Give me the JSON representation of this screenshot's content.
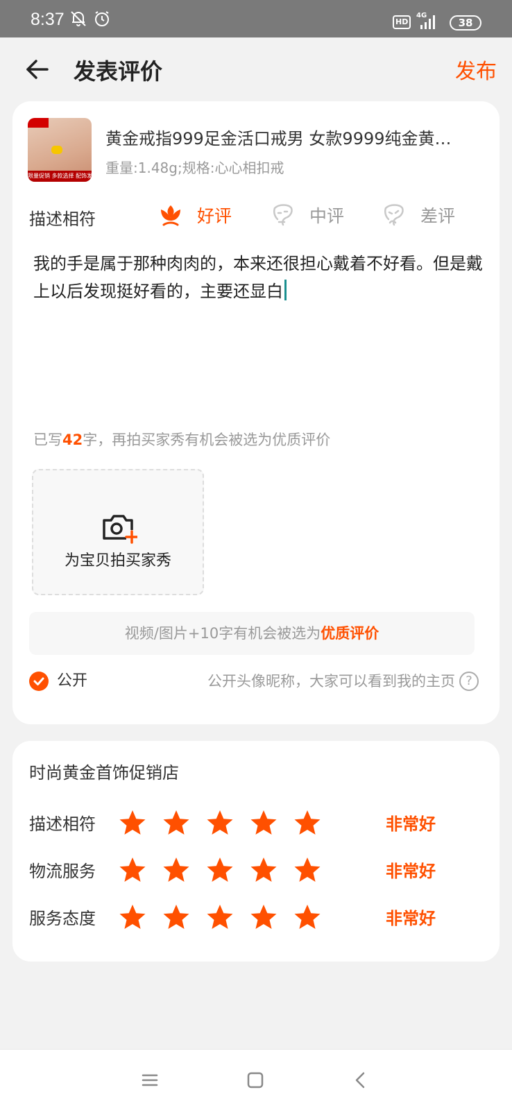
{
  "status_bar": {
    "time": "8:37",
    "hd": "HD",
    "network": "4G",
    "battery": "38"
  },
  "header": {
    "title": "发表评价",
    "publish_label": "发布"
  },
  "product": {
    "title": "黄金戒指999足金活口戒男 女款9999纯金黄…",
    "spec": "重量:1.48g;规格:心心相扣戒",
    "image_tag": "限量促销 多款选择 配饰发票"
  },
  "rating": {
    "label": "描述相符",
    "options": [
      {
        "label": "好评",
        "icon": "flower-icon",
        "selected": true
      },
      {
        "label": "中评",
        "icon": "neutral-face-icon",
        "selected": false
      },
      {
        "label": "差评",
        "icon": "sad-face-icon",
        "selected": false
      }
    ]
  },
  "review": {
    "text": "我的手是属于那种肉肉的，本来还很担心戴着不好看。但是戴上以后发现挺好看的，主要还显白",
    "count_prefix": "已写",
    "count": "42",
    "count_suffix": "字，再拍买家秀有机会被选为优质评价"
  },
  "photo": {
    "label": "为宝贝拍买家秀",
    "icon": "camera-add-icon"
  },
  "tip": {
    "text": "视频/图片+10字有机会被选为",
    "highlight": "优质评价"
  },
  "public": {
    "label": "公开",
    "checked": true,
    "description": "公开头像昵称，大家可以看到我的主页",
    "help": "?"
  },
  "shop": {
    "name": "时尚黄金首饰促销店",
    "scores": [
      {
        "label": "描述相符",
        "stars": 5,
        "word": "非常好"
      },
      {
        "label": "物流服务",
        "stars": 5,
        "word": "非常好"
      },
      {
        "label": "服务态度",
        "stars": 5,
        "word": "非常好"
      }
    ]
  },
  "colors": {
    "accent": "#ff5000",
    "muted": "#999999",
    "background": "#f2f2f2"
  },
  "bottom_nav": [
    "menu-icon",
    "home-icon",
    "back-icon"
  ]
}
